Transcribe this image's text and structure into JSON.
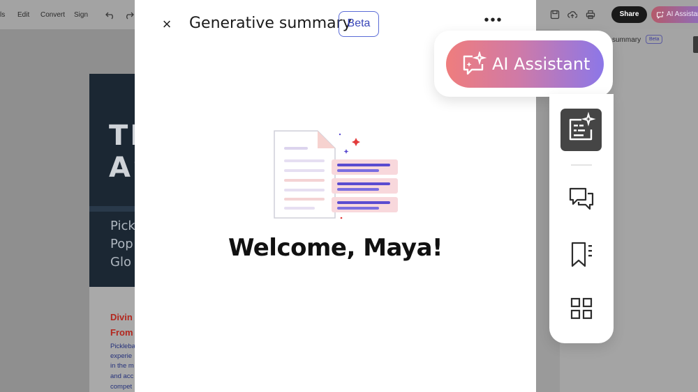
{
  "toolbar": {
    "menu_partial": "ls",
    "menu": [
      "Edit",
      "Convert",
      "Sign"
    ],
    "share_label": "Share",
    "ai_assistant_label": "AI Assistan"
  },
  "document": {
    "hero_title_lines": [
      "TH",
      "AS"
    ],
    "hero_subtitle_lines": [
      "Pick",
      "Pop",
      "Glo"
    ],
    "section_heading_lines": [
      "Divin",
      "From"
    ],
    "body_lines": [
      "Pickleba",
      "experie",
      "in the m",
      "and acc",
      "compet"
    ]
  },
  "right_panel": {
    "title_partial": "summary",
    "badge": "Beta"
  },
  "panel": {
    "title": "Generative summary",
    "badge": "Beta",
    "close_glyph": "×",
    "more_glyph": "•••",
    "welcome": "Welcome, Maya!"
  },
  "ai_callout": {
    "label": "AI Assistant"
  },
  "rail": {
    "items": [
      {
        "icon": "generative-summary-icon",
        "active": true
      },
      {
        "icon": "comments-icon",
        "active": false
      },
      {
        "icon": "bookmark-icon",
        "active": false
      },
      {
        "icon": "grid-icon",
        "active": false
      }
    ]
  },
  "colors": {
    "accent_blue": "#3946b8",
    "gradient_start": "#ef7d7d",
    "gradient_end": "#8c77e8",
    "rail_active": "#454545",
    "doc_red": "#b3271e",
    "doc_blue": "#23307a"
  }
}
